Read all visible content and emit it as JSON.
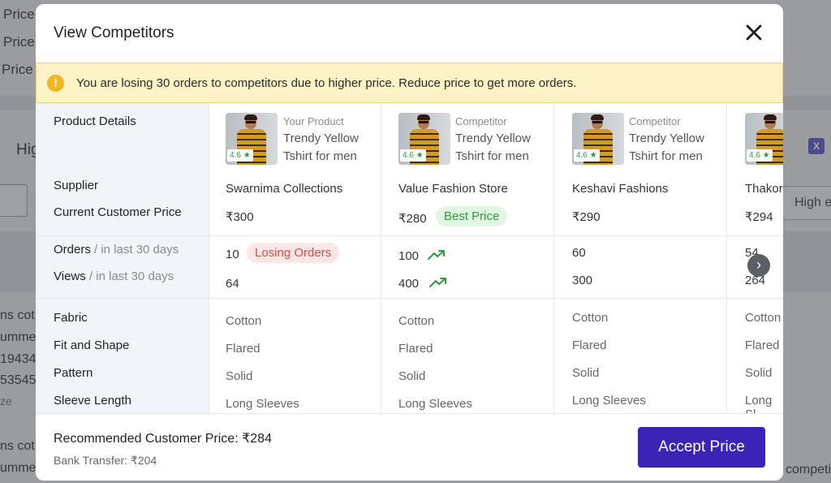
{
  "background": {
    "lines": [
      "Price",
      "Price",
      "Price",
      "Hig",
      "ns cot",
      "umme",
      "19434",
      "53545",
      "ze",
      "ns cot",
      "umme"
    ],
    "right_select": "High e",
    "right_text": "competi"
  },
  "modal": {
    "title": "View Competitors",
    "alert": "You are losing 30 orders to competitors due to higher price. Reduce price to get more orders.",
    "labels": {
      "product_details": "Product Details",
      "supplier": "Supplier",
      "customer_price": "Current Customer Price",
      "orders": "Orders",
      "orders_sub": "/ in last 30 days",
      "views": "Views",
      "views_sub": "/ in last 30 days",
      "fabric": "Fabric",
      "fit": "Fit and Shape",
      "pattern": "Pattern",
      "sleeve": "Sleeve Length"
    },
    "products": [
      {
        "tag": "Your Product",
        "name1": "Trendy Yellow",
        "name2": "Tshirt for men",
        "rating": "4.6",
        "supplier": "Swarnima Collections",
        "price": "₹300",
        "price_badge": "",
        "orders": "10",
        "orders_badge": "Losing Orders",
        "views": "64",
        "fabric": "Cotton",
        "fit": "Flared",
        "pattern": "Solid",
        "sleeve": "Long Sleeves"
      },
      {
        "tag": "Competitor",
        "name1": "Trendy Yellow",
        "name2": "Tshirt for men",
        "rating": "4.6",
        "supplier": "Value Fashion Store",
        "price": "₹280",
        "price_badge": "Best Price",
        "orders": "100",
        "orders_badge": "",
        "views": "400",
        "fabric": "Cotton",
        "fit": "Flared",
        "pattern": "Solid",
        "sleeve": "Long Sleeves"
      },
      {
        "tag": "Competitor",
        "name1": "Trendy Yellow",
        "name2": "Tshirt for men",
        "rating": "4.6",
        "supplier": "Keshavi Fashions",
        "price": "₹290",
        "price_badge": "",
        "orders": "60",
        "orders_badge": "",
        "views": "300",
        "fabric": "Cotton",
        "fit": "Flared",
        "pattern": "Solid",
        "sleeve": "Long Sleeves"
      },
      {
        "tag": "",
        "name1": "",
        "name2": "",
        "rating": "4.6",
        "supplier": "Thakor",
        "price": "₹294",
        "price_badge": "",
        "orders": "54",
        "orders_badge": "",
        "views": "264",
        "fabric": "Cotton",
        "fit": "Flared",
        "pattern": "Solid",
        "sleeve": "Long Sl"
      }
    ],
    "footer": {
      "recommended": "Recommended Customer Price: ₹284",
      "bank": "Bank Transfer: ₹204",
      "accept": "Accept Price"
    }
  },
  "colors": {
    "accent": "#3b23b6",
    "alert_bg": "#fdf3c6",
    "losing": "#e04848",
    "best": "#2e9a3e"
  },
  "icons": [
    "close-icon",
    "info-icon",
    "star-icon",
    "trend-up-icon",
    "chevron-right-icon",
    "excel-icon"
  ]
}
